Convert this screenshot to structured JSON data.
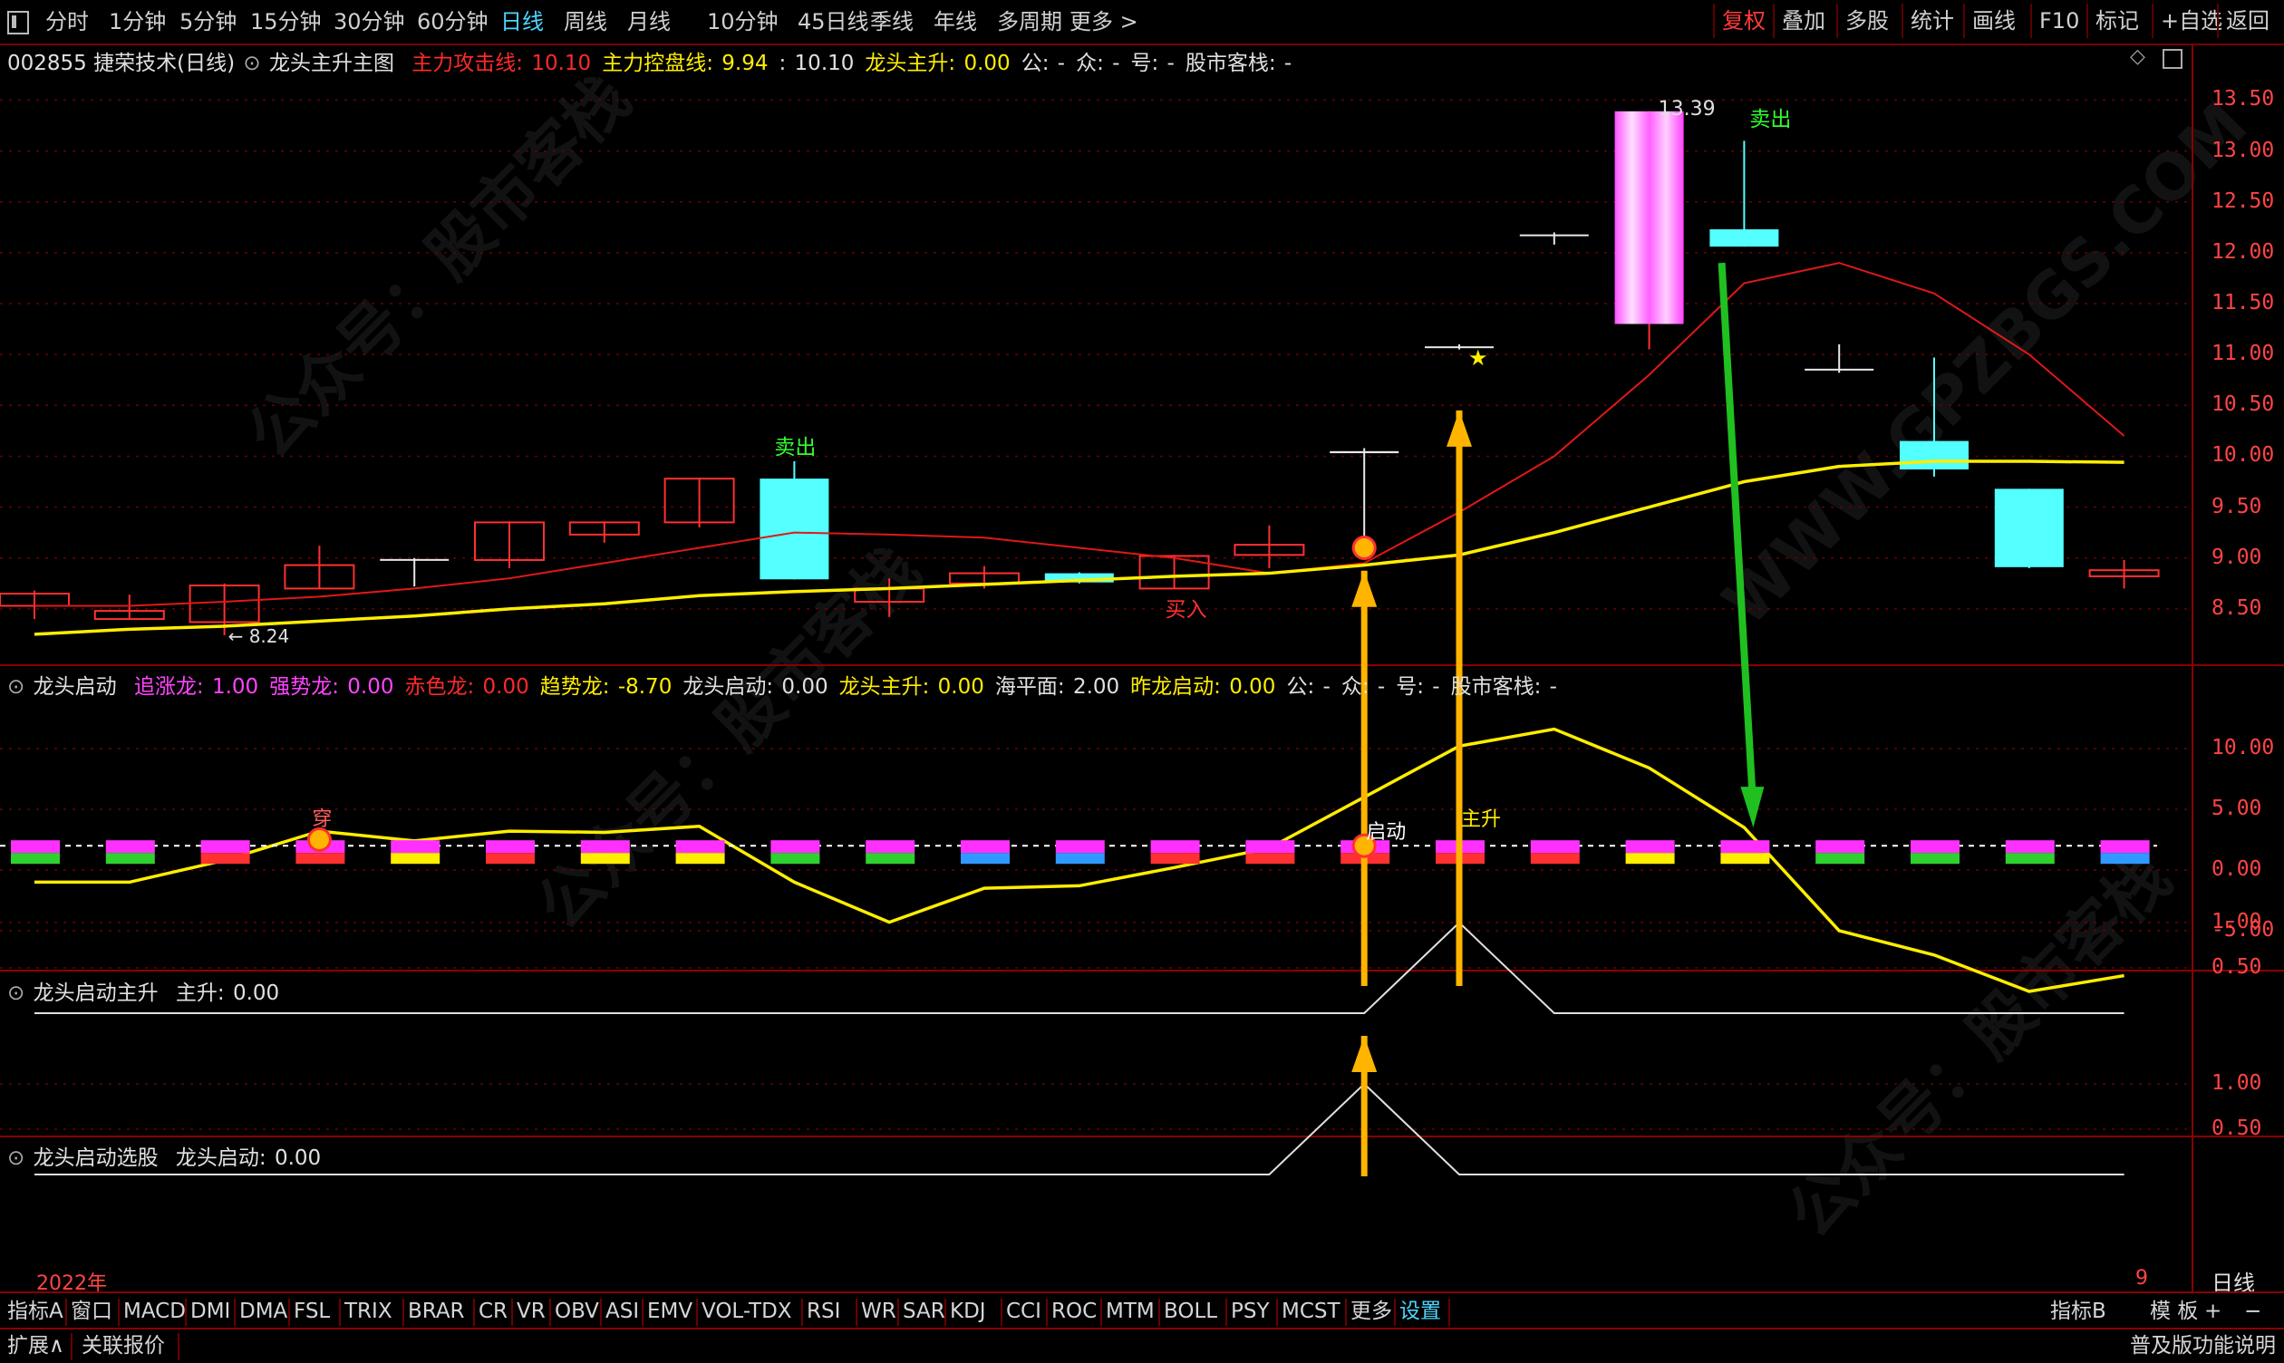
{
  "periods": [
    "分时",
    "1分钟",
    "5分钟",
    "15分钟",
    "30分钟",
    "60分钟",
    "日线",
    "周线",
    "月线",
    "10分钟",
    "45日线",
    "季线",
    "年线",
    "多周期",
    "更多 >"
  ],
  "active_period": "日线",
  "right_tools": [
    "复权",
    "叠加",
    "多股",
    "统计",
    "画线",
    "F10",
    "标记",
    "+自选",
    "返回"
  ],
  "main_panel": {
    "stock": "002855 捷荣技术(日线)",
    "indicator": "龙头主升主图",
    "fields": [
      {
        "label": "主力攻击线: ",
        "value": "10.10",
        "color": "#ff2a2a"
      },
      {
        "label": "主力控盘线: ",
        "value": "9.94",
        "color": "#ffee00"
      },
      {
        "label": ": ",
        "value": "10.10",
        "color": "#e0e0e0"
      },
      {
        "label": "龙头主升: ",
        "value": "0.00",
        "color": "#ffee00"
      },
      {
        "label": "公: ",
        "value": "-",
        "color": "#e0e0e0"
      },
      {
        "label": "众: ",
        "value": "-",
        "color": "#e0e0e0"
      },
      {
        "label": "号: ",
        "value": "-",
        "color": "#e0e0e0"
      },
      {
        "label": "股市客栈: ",
        "value": "-",
        "color": "#e0e0e0"
      }
    ],
    "axis": [
      "13.50",
      "13.00",
      "12.50",
      "12.00",
      "11.50",
      "11.00",
      "10.50",
      "10.00",
      "9.50",
      "9.00",
      "8.50"
    ],
    "high_label": "13.39",
    "low_label": "8.24",
    "sell_labels": [
      "卖出",
      "卖出"
    ],
    "buy_label": "买入"
  },
  "panel2": {
    "name": "龙头启动",
    "fields": [
      {
        "label": "追涨龙: ",
        "value": "1.00",
        "color": "#ff44ff"
      },
      {
        "label": "强势龙: ",
        "value": "0.00",
        "color": "#ff44ff"
      },
      {
        "label": "赤色龙: ",
        "value": "0.00",
        "color": "#ff2a2a"
      },
      {
        "label": "趋势龙: ",
        "value": "-8.70",
        "color": "#ffee00"
      },
      {
        "label": "龙头启动: ",
        "value": "0.00",
        "color": "#e0e0e0"
      },
      {
        "label": "龙头主升: ",
        "value": "0.00",
        "color": "#ffee00"
      },
      {
        "label": "海平面: ",
        "value": "2.00",
        "color": "#e0e0e0"
      },
      {
        "label": "昨龙启动: ",
        "value": "0.00",
        "color": "#ffee00"
      },
      {
        "label": "公: ",
        "value": "-",
        "color": "#e0e0e0"
      },
      {
        "label": "众: ",
        "value": "-",
        "color": "#e0e0e0"
      },
      {
        "label": "号: ",
        "value": "-",
        "color": "#e0e0e0"
      },
      {
        "label": "股市客栈: ",
        "value": "-",
        "color": "#e0e0e0"
      }
    ],
    "axis": [
      "10.00",
      "5.00",
      "0.00",
      "-5.00"
    ],
    "labels": {
      "chuan": "穿",
      "qidong": "启动",
      "zhusheng": "主升"
    }
  },
  "panel3": {
    "name": "龙头启动主升",
    "field_label": "主升: ",
    "field_value": "0.00",
    "axis": [
      "1.00",
      "0.50"
    ]
  },
  "panel4": {
    "name": "龙头启动选股",
    "field_label": "龙头启动: ",
    "field_value": "0.00",
    "axis": [
      "1.00",
      "0.50"
    ]
  },
  "year_label": "2022年",
  "right_small": "9",
  "right_period": "日线",
  "bottom_tabs": [
    "指标A",
    "窗口",
    "MACD",
    "DMI",
    "DMA",
    "FSL",
    "TRIX",
    "BRAR",
    "CR",
    "VR",
    "OBV",
    "ASI",
    "EMV",
    "VOL-TDX",
    "RSI",
    "WR",
    "SAR",
    "KDJ",
    "CCI",
    "ROC",
    "MTM",
    "BOLL",
    "PSY",
    "MCST",
    "更多",
    "设置"
  ],
  "active_bottom_tab": "设置",
  "bottom_right": [
    "指标B",
    "模 板",
    "+",
    "−"
  ],
  "status_left": [
    "扩展∧",
    "关联报价"
  ],
  "status_right": "普及版功能说明",
  "chart_data": {
    "type": "candlestick",
    "y_range": [
      8.0,
      13.7
    ],
    "candles": [
      {
        "o": 8.53,
        "c": 8.65,
        "h": 8.68,
        "l": 8.4
      },
      {
        "o": 8.4,
        "c": 8.48,
        "h": 8.64,
        "l": 8.4
      },
      {
        "o": 8.37,
        "c": 8.73,
        "h": 8.75,
        "l": 8.24
      },
      {
        "o": 8.7,
        "c": 8.93,
        "h": 9.12,
        "l": 8.7
      },
      {
        "o": 8.98,
        "c": 8.99,
        "h": 9.0,
        "l": 8.72
      },
      {
        "o": 8.98,
        "c": 9.35,
        "h": 9.36,
        "l": 8.9
      },
      {
        "o": 9.23,
        "c": 9.35,
        "h": 9.36,
        "l": 9.15
      },
      {
        "o": 9.35,
        "c": 9.78,
        "h": 9.79,
        "l": 9.3
      },
      {
        "o": 9.78,
        "c": 8.79,
        "h": 9.95,
        "l": 8.79
      },
      {
        "o": 8.57,
        "c": 8.7,
        "h": 8.8,
        "l": 8.42
      },
      {
        "o": 8.75,
        "c": 8.85,
        "h": 8.92,
        "l": 8.7
      },
      {
        "o": 8.85,
        "c": 8.76,
        "h": 8.86,
        "l": 8.75
      },
      {
        "o": 8.7,
        "c": 9.02,
        "h": 9.03,
        "l": 8.7
      },
      {
        "o": 9.03,
        "c": 9.13,
        "h": 9.32,
        "l": 8.9
      },
      {
        "o": 10.05,
        "c": 10.03,
        "h": 10.08,
        "l": 9.15
      },
      {
        "o": 11.07,
        "c": 11.08,
        "h": 11.1,
        "l": 11.05
      },
      {
        "o": 12.17,
        "c": 12.18,
        "h": 12.2,
        "l": 12.08
      },
      {
        "o": 11.3,
        "c": 13.39,
        "h": 13.39,
        "l": 11.05
      },
      {
        "o": 12.23,
        "c": 12.06,
        "h": 13.1,
        "l": 12.06
      },
      {
        "o": 10.85,
        "c": 10.86,
        "h": 11.1,
        "l": 10.82
      },
      {
        "o": 10.15,
        "c": 9.87,
        "h": 10.97,
        "l": 9.8
      },
      {
        "o": 9.68,
        "c": 8.91,
        "h": 9.68,
        "l": 8.9
      },
      {
        "o": 8.82,
        "c": 8.88,
        "h": 8.98,
        "l": 8.7
      }
    ],
    "attack_line": [
      8.53,
      8.53,
      8.57,
      8.62,
      8.7,
      8.8,
      8.95,
      9.1,
      9.25,
      9.23,
      9.2,
      9.1,
      9.0,
      8.85,
      8.95,
      9.45,
      10.0,
      10.8,
      11.7,
      11.9,
      11.6,
      11.0,
      10.2
    ],
    "control_line": [
      8.25,
      8.3,
      8.33,
      8.38,
      8.43,
      8.5,
      8.55,
      8.63,
      8.67,
      8.7,
      8.74,
      8.78,
      8.82,
      8.85,
      8.93,
      9.03,
      9.25,
      9.5,
      9.75,
      9.9,
      9.95,
      9.95,
      9.94
    ],
    "sub_indicator_trend": [
      -1.0,
      -1.0,
      0.8,
      3.2,
      2.4,
      3.2,
      3.1,
      3.6,
      -1.0,
      -4.3,
      -1.5,
      -1.3,
      0.2,
      1.8,
      6.0,
      10.2,
      11.6,
      8.4,
      3.5,
      -5.0,
      -7.0,
      -10.0,
      -8.7
    ],
    "zhusheng": [
      0,
      0,
      0,
      0,
      0,
      0,
      0,
      0,
      0,
      0,
      0,
      0,
      0,
      0,
      0,
      1,
      0,
      0,
      0,
      0,
      0,
      0,
      0
    ],
    "qidong": [
      0,
      0,
      0,
      0,
      0,
      0,
      0,
      0,
      0,
      0,
      0,
      0,
      0,
      0,
      1,
      0,
      0,
      0,
      0,
      0,
      0,
      0,
      0
    ]
  }
}
